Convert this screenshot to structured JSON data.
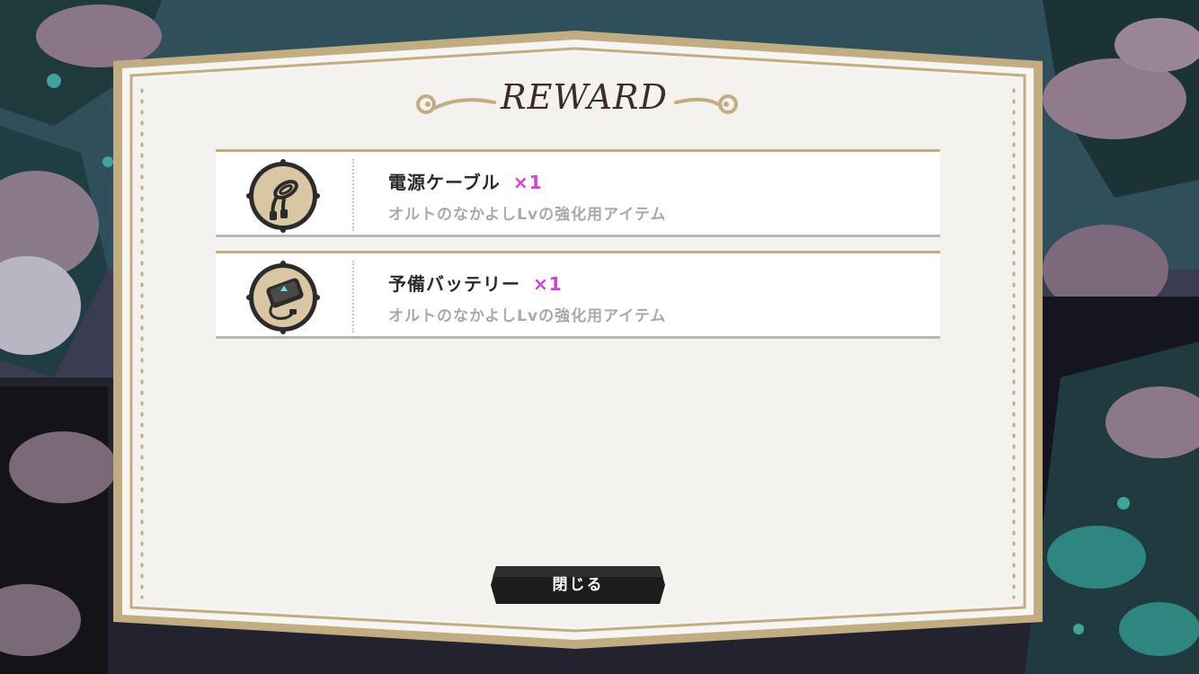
{
  "dialog": {
    "title": "REWARD",
    "close_label": "閉じる"
  },
  "rewards": [
    {
      "name": "電源ケーブル",
      "qty": "×1",
      "desc": "オルトのなかよしLvの強化用アイテム",
      "icon": "power-cable-icon"
    },
    {
      "name": "予備バッテリー",
      "qty": "×1",
      "desc": "オルトのなかよしLvの強化用アイテム",
      "icon": "spare-battery-icon"
    }
  ],
  "colors": {
    "frame_gold": "#c2ad83",
    "panel_bg": "#f4f2ef",
    "qty_magenta": "#d63fd3",
    "title_brown": "#3e2d24",
    "button_dark": "#1c1c1c"
  }
}
